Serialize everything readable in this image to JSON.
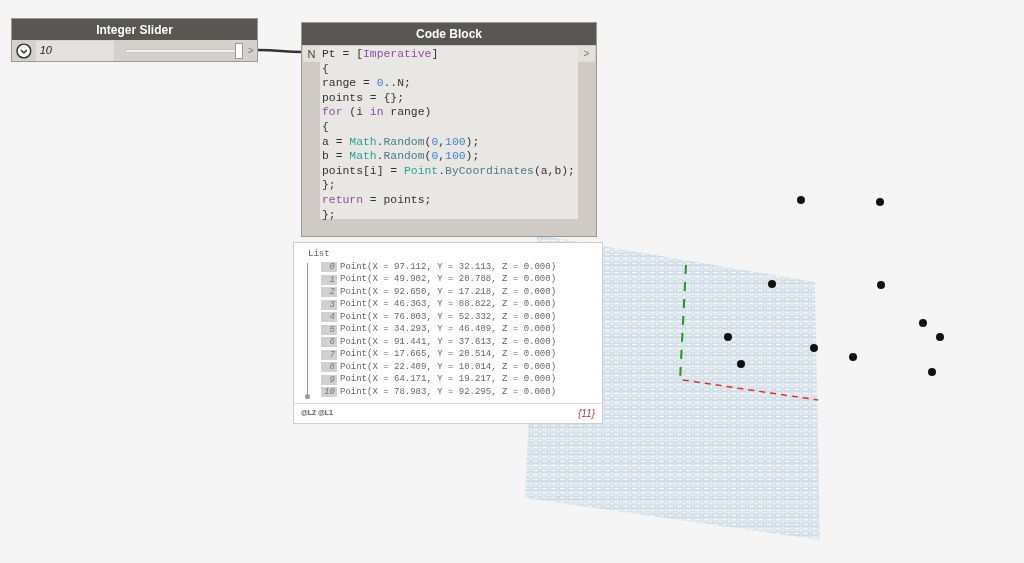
{
  "slider": {
    "title": "Integer Slider",
    "value": "10",
    "level": 0.97,
    "output_port": ">"
  },
  "code_block": {
    "title": "Code Block",
    "input_port": "N",
    "output_port": ">",
    "lines": [
      [
        {
          "kind": "plain",
          "text": "Pt = ["
        },
        {
          "kind": "keyword",
          "text": "Imperative"
        },
        {
          "kind": "plain",
          "text": "]"
        }
      ],
      [
        {
          "kind": "plain",
          "text": "{"
        }
      ],
      [
        {
          "kind": "plain",
          "text": "range = "
        },
        {
          "kind": "number",
          "text": "0"
        },
        {
          "kind": "plain",
          "text": "..N;"
        }
      ],
      [
        {
          "kind": "plain",
          "text": "points = {};"
        }
      ],
      [
        {
          "kind": "keyword",
          "text": "for"
        },
        {
          "kind": "plain",
          "text": " (i "
        },
        {
          "kind": "keyword",
          "text": "in"
        },
        {
          "kind": "plain",
          "text": " range)"
        }
      ],
      [
        {
          "kind": "plain",
          "text": "{"
        }
      ],
      [
        {
          "kind": "plain",
          "text": "a = "
        },
        {
          "kind": "class",
          "text": "Math"
        },
        {
          "kind": "plain",
          "text": "."
        },
        {
          "kind": "method",
          "text": "Random"
        },
        {
          "kind": "plain",
          "text": "("
        },
        {
          "kind": "number",
          "text": "0"
        },
        {
          "kind": "plain",
          "text": ","
        },
        {
          "kind": "number",
          "text": "100"
        },
        {
          "kind": "plain",
          "text": ");"
        }
      ],
      [
        {
          "kind": "plain",
          "text": "b = "
        },
        {
          "kind": "class",
          "text": "Math"
        },
        {
          "kind": "plain",
          "text": "."
        },
        {
          "kind": "method",
          "text": "Random"
        },
        {
          "kind": "plain",
          "text": "("
        },
        {
          "kind": "number",
          "text": "0"
        },
        {
          "kind": "plain",
          "text": ","
        },
        {
          "kind": "number",
          "text": "100"
        },
        {
          "kind": "plain",
          "text": ");"
        }
      ],
      [
        {
          "kind": "plain",
          "text": "points[i] = "
        },
        {
          "kind": "class",
          "text": "Point"
        },
        {
          "kind": "plain",
          "text": "."
        },
        {
          "kind": "method",
          "text": "ByCoordinates"
        },
        {
          "kind": "plain",
          "text": "(a,b);"
        }
      ],
      [
        {
          "kind": "plain",
          "text": "};"
        }
      ],
      [
        {
          "kind": "keyword",
          "text": "return"
        },
        {
          "kind": "plain",
          "text": " = points;"
        }
      ],
      [
        {
          "kind": "plain",
          "text": "};"
        }
      ]
    ]
  },
  "preview": {
    "header": "List",
    "items": [
      {
        "index": "0",
        "text": "Point(X = 97.112, Y = 32.113, Z = 0.000)"
      },
      {
        "index": "1",
        "text": "Point(X = 49.902, Y = 20.788, Z = 0.000)"
      },
      {
        "index": "2",
        "text": "Point(X = 92.650, Y = 17.218, Z = 0.000)"
      },
      {
        "index": "3",
        "text": "Point(X = 46.363, Y = 88.822, Z = 0.000)"
      },
      {
        "index": "4",
        "text": "Point(X = 76.803, Y = 52.332, Z = 0.000)"
      },
      {
        "index": "5",
        "text": "Point(X = 34.293, Y = 46.409, Z = 0.000)"
      },
      {
        "index": "6",
        "text": "Point(X = 91.441, Y = 37.613, Z = 0.000)"
      },
      {
        "index": "7",
        "text": "Point(X = 17.665, Y = 20.514, Z = 0.000)"
      },
      {
        "index": "8",
        "text": "Point(X = 22.409, Y = 10.014, Z = 0.000)"
      },
      {
        "index": "9",
        "text": "Point(X = 64.171, Y = 19.217, Z = 0.000)"
      },
      {
        "index": "10",
        "text": "Point(X = 78.983, Y = 92.295, Z = 0.000)"
      }
    ],
    "levels": "@L2 @L1",
    "count": "{11}"
  }
}
